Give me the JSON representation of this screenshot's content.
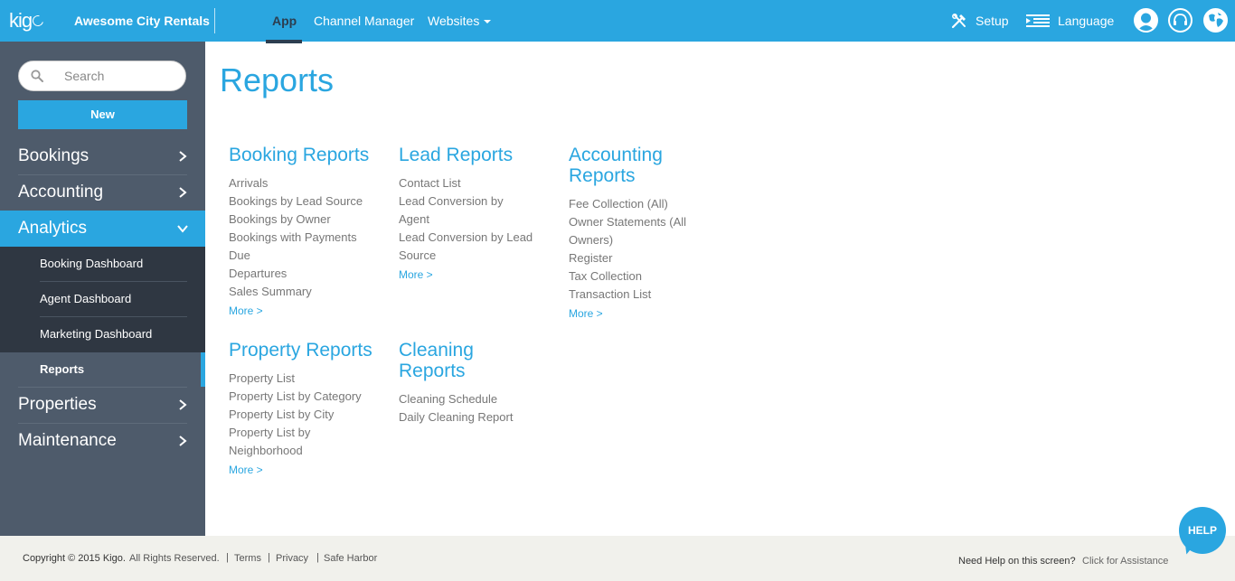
{
  "topbar": {
    "logo": "kig",
    "company": "Awesome City Rentals",
    "nav": [
      "App",
      "Channel Manager",
      "Websites"
    ],
    "setup": "Setup",
    "language": "Language"
  },
  "sidebar": {
    "search_placeholder": "Search",
    "new_label": "New",
    "items": [
      "Bookings",
      "Accounting",
      "Analytics",
      "Properties",
      "Maintenance"
    ],
    "analytics_sub": [
      "Booking Dashboard",
      "Agent Dashboard",
      "Marketing Dashboard",
      "Reports"
    ]
  },
  "main": {
    "title": "Reports",
    "booking": {
      "title": "Booking Reports",
      "links": [
        "Arrivals",
        "Bookings by Lead Source",
        "Bookings by Owner",
        "Bookings with Payments",
        "Due",
        "Departures",
        "Sales Summary"
      ],
      "more": "More >"
    },
    "lead": {
      "title": "Lead Reports",
      "links": [
        "Contact List",
        "Lead Conversion by",
        "Agent",
        "Lead Conversion by Lead",
        "Source"
      ],
      "more": "More >"
    },
    "accounting": {
      "title_1": "Accounting",
      "title_2": "Reports",
      "links": [
        "Fee Collection (All)",
        "Owner Statements (All",
        "Owners)",
        "Register",
        "Tax Collection",
        "Transaction List"
      ],
      "more": "More >"
    },
    "property": {
      "title": "Property Reports",
      "links": [
        "Property List",
        "Property List by Category",
        "Property List by City",
        "Property List by",
        "Neighborhood"
      ],
      "more": "More >"
    },
    "cleaning": {
      "title_1": "Cleaning",
      "title_2": "Reports",
      "links": [
        "Cleaning Schedule",
        "Daily Cleaning Report"
      ]
    }
  },
  "footer": {
    "copyright": "Copyright © 2015 Kigo.",
    "rights": "All Rights Reserved.",
    "sep": "|",
    "terms": "Terms",
    "privacy": "Privacy",
    "safe_harbor": "Safe Harbor",
    "help_question": "Need Help on this screen?",
    "help_link": "Click for Assistance",
    "help_bubble": "HELP"
  },
  "colors": {
    "accent": "#2aa6e0",
    "sidebar": "#4e5b6b",
    "submenu": "#2f3742",
    "footer": "#f1f1ec"
  },
  "icons": [
    "setup-tools-icon",
    "language-icon",
    "user-icon",
    "support-headset-icon",
    "globe-icon",
    "search-icon",
    "chevron-right-icon",
    "chevron-down-icon"
  ]
}
